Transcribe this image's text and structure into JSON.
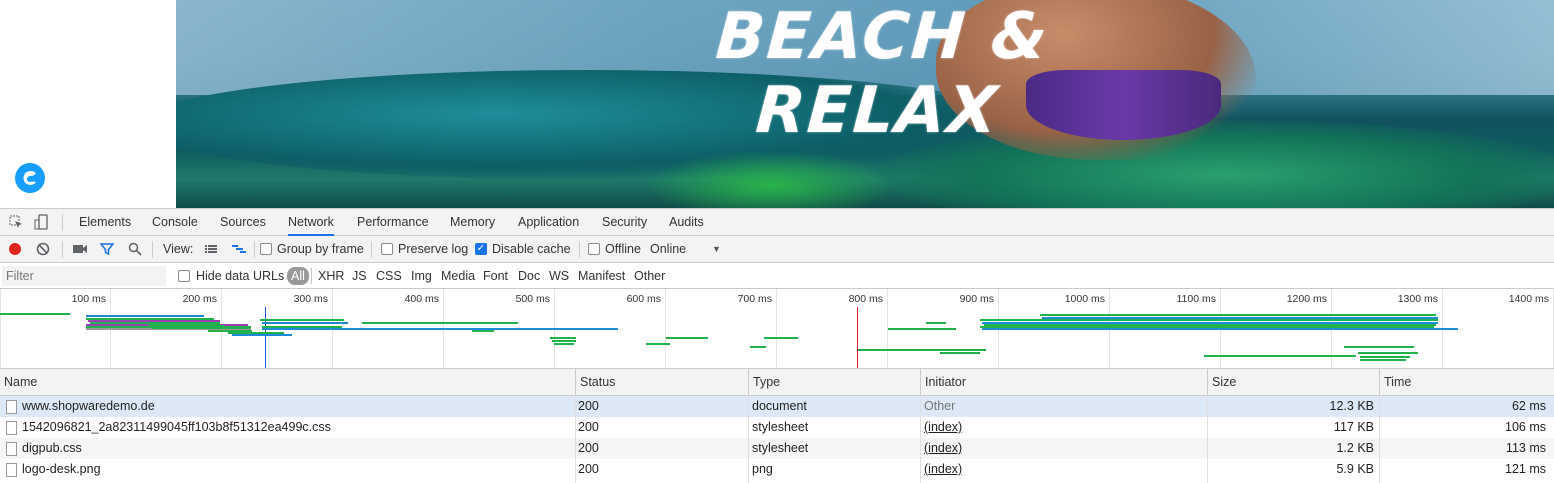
{
  "page": {
    "hero_title": "BEACH & RELAX"
  },
  "devtools": {
    "tabs": [
      {
        "label": "Elements"
      },
      {
        "label": "Console"
      },
      {
        "label": "Sources"
      },
      {
        "label": "Network",
        "active": true
      },
      {
        "label": "Performance"
      },
      {
        "label": "Memory"
      },
      {
        "label": "Application"
      },
      {
        "label": "Security"
      },
      {
        "label": "Audits"
      }
    ],
    "toolbar": {
      "view_label": "View:",
      "group_by_frame": "Group by frame",
      "group_by_frame_checked": false,
      "preserve_log": "Preserve log",
      "preserve_log_checked": false,
      "disable_cache": "Disable cache",
      "disable_cache_checked": true,
      "offline": "Offline",
      "offline_checked": false,
      "throttling_value": "Online"
    },
    "filter": {
      "placeholder": "Filter",
      "hide_data_urls": "Hide data URLs",
      "types": [
        "All",
        "XHR",
        "JS",
        "CSS",
        "Img",
        "Media",
        "Font",
        "Doc",
        "WS",
        "Manifest",
        "Other"
      ],
      "active_type": "All"
    },
    "overview": {
      "ticks": [
        "100 ms",
        "200 ms",
        "300 ms",
        "400 ms",
        "500 ms",
        "600 ms",
        "700 ms",
        "800 ms",
        "900 ms",
        "1000 ms",
        "1100 ms",
        "1200 ms",
        "1300 ms",
        "1400 ms"
      ],
      "dom_content_loaded_ms": 240,
      "load_ms": 773
    },
    "table": {
      "columns": [
        "Name",
        "Status",
        "Type",
        "Initiator",
        "Size",
        "Time"
      ],
      "rows": [
        {
          "name": "www.shopwaredemo.de",
          "status": "200",
          "type": "document",
          "initiator": "Other",
          "size": "12.3 KB",
          "time": "62 ms"
        },
        {
          "name": "1542096821_2a82311499045ff103b8f51312ea499c.css",
          "status": "200",
          "type": "stylesheet",
          "initiator": "(index)",
          "size": "117 KB",
          "time": "106 ms"
        },
        {
          "name": "digpub.css",
          "status": "200",
          "type": "stylesheet",
          "initiator": "(index)",
          "size": "1.2 KB",
          "time": "113 ms"
        },
        {
          "name": "logo-desk.png",
          "status": "200",
          "type": "png",
          "initiator": "(index)",
          "size": "5.9 KB",
          "time": "121 ms"
        }
      ]
    }
  },
  "colors": {
    "accent": "#1a73e8",
    "record": "#e0241e",
    "bar_green": "#22b24c",
    "bar_blue": "#1e8ad8",
    "bar_purple": "#9b3fb5",
    "logo": "#189eff"
  }
}
